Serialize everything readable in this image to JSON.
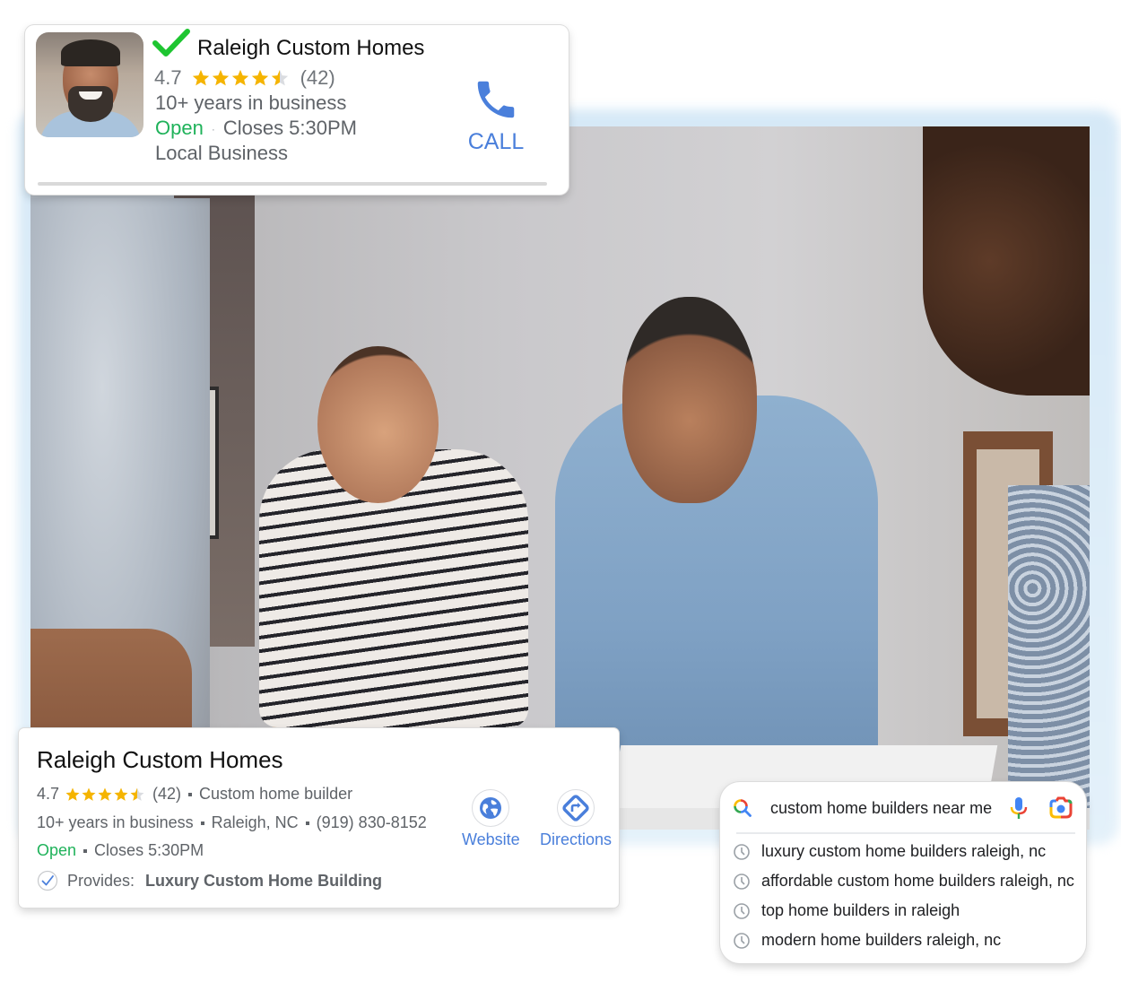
{
  "top_card": {
    "business_name": "Raleigh Custom Homes",
    "rating": "4.7",
    "stars": 4.5,
    "review_count": "(42)",
    "years": "10+ years in business",
    "status": "Open",
    "closes": "Closes 5:30PM",
    "category": "Local Business",
    "call_label": "CALL",
    "icons": {
      "verified": "check-icon",
      "call": "phone-icon"
    }
  },
  "listing_card": {
    "business_name": "Raleigh Custom Homes",
    "rating": "4.7",
    "stars": 4.5,
    "review_count": "(42)",
    "category": "Custom home builder",
    "years": "10+ years in business",
    "location": "Raleigh, NC",
    "phone": "(919) 830-8152",
    "status": "Open",
    "closes": "Closes 5:30PM",
    "provides_label": "Provides:",
    "provides_value": "Luxury Custom Home Building",
    "actions": [
      {
        "label": "Website",
        "icon": "globe-icon"
      },
      {
        "label": "Directions",
        "icon": "directions-icon"
      }
    ]
  },
  "search": {
    "query": "custom home builders near me",
    "suggestions": [
      "luxury custom home builders raleigh, nc",
      "affordable custom home builders raleigh, nc",
      "top home builders in raleigh",
      "modern home builders raleigh, nc"
    ],
    "icons": {
      "search": "google-search-icon",
      "voice": "mic-icon",
      "lens": "lens-camera-icon",
      "history": "clock-icon"
    }
  },
  "colors": {
    "accent_blue": "#4a7fdb",
    "open_green": "#1fb25a",
    "star_gold": "#f5b400",
    "verified_green": "#1ec531"
  }
}
